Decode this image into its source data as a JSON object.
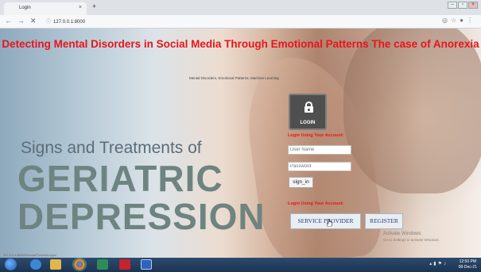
{
  "browser": {
    "tab_title": "Login",
    "tab_close": "×",
    "new_tab": "+",
    "nav_back": "←",
    "nav_forward": "→",
    "nav_reload": "✕",
    "url": "127.0.0.1:8000"
  },
  "page": {
    "title": "Detecting Mental Disorders in Social Media Through Emotional Patterns The case of Anorexia",
    "subtitle": "Mental Disorders, Emotional Patterns, Machine Learning",
    "poster_line1": "Signs and Treatments of",
    "poster_line2": "GERIATRIC",
    "poster_line3": "DEPRESSION"
  },
  "login": {
    "badge_label": "LOGIN",
    "heading": "Login Using Your Account:",
    "username_placeholder": "User Name",
    "password_placeholder": "Password",
    "signin_label": "sign_in",
    "heading2": "Login Using Your Account:",
    "service_provider_label": "SERVICE PROVIDER",
    "register_label": "REGISTER"
  },
  "overlay": {
    "activate_line1": "Activate Windows",
    "activate_line2": "Go to Settings to activate Windows.",
    "status_url": "127.0.0.1:8000/ServiceProviderLogin/"
  },
  "taskbar": {
    "time": "12:50 PM",
    "date": "08-Dec-21",
    "icons": [
      "windows-start",
      "ie",
      "file-explorer",
      "chrome",
      "app-green",
      "acrobat",
      "app-blue"
    ]
  },
  "colors": {
    "title_red": "#e8151b",
    "poster_green": "#6d8480",
    "link_blue": "#233c87"
  }
}
